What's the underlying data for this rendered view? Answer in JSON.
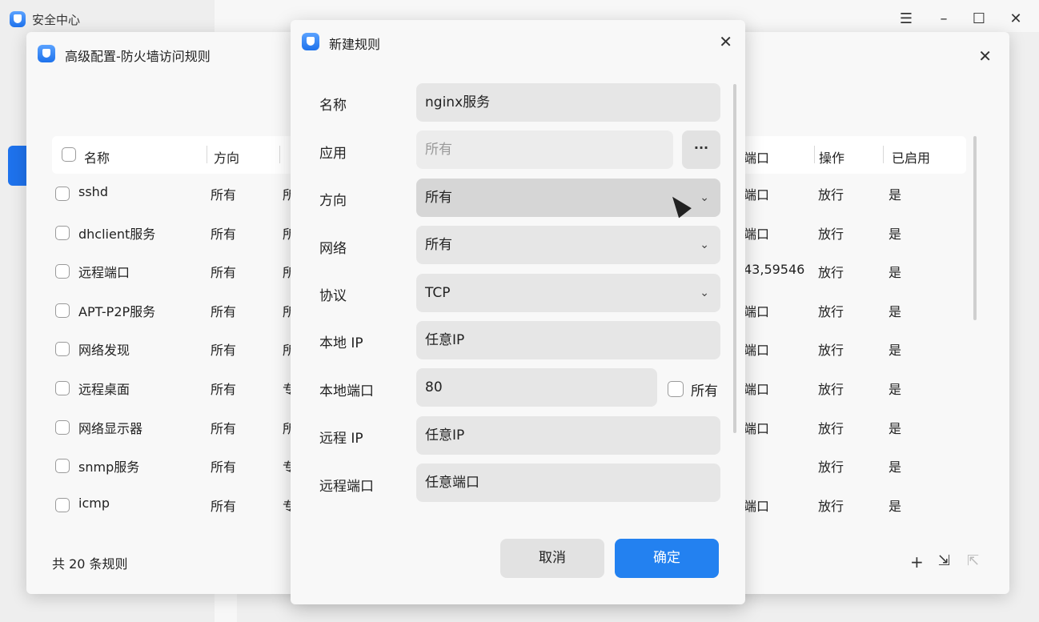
{
  "main_window": {
    "title": "安全中心",
    "menu_icon": "hamburger-icon",
    "minimize_icon": "minimize-icon",
    "maximize_icon": "maximize-icon",
    "close_icon": "close-icon"
  },
  "advanced_window": {
    "title": "高级配置-防火墙访问规则",
    "columns": [
      "名称",
      "方向",
      "端口",
      "操作",
      "已启用"
    ],
    "rows": [
      {
        "name": "sshd",
        "direction": "所有",
        "col3": "所",
        "port": "端口",
        "action": "放行",
        "enabled": "是"
      },
      {
        "name": "dhclient服务",
        "direction": "所有",
        "col3": "所",
        "port": "端口",
        "action": "放行",
        "enabled": "是"
      },
      {
        "name": "远程端口",
        "direction": "所有",
        "col3": "所",
        "port": "43,59546",
        "action": "放行",
        "enabled": "是"
      },
      {
        "name": "APT-P2P服务",
        "direction": "所有",
        "col3": "所",
        "port": "端口",
        "action": "放行",
        "enabled": "是"
      },
      {
        "name": "网络发现",
        "direction": "所有",
        "col3": "所",
        "port": "端口",
        "action": "放行",
        "enabled": "是"
      },
      {
        "name": "远程桌面",
        "direction": "所有",
        "col3": "专",
        "port": "端口",
        "action": "放行",
        "enabled": "是"
      },
      {
        "name": "网络显示器",
        "direction": "所有",
        "col3": "所",
        "port": "端口",
        "action": "放行",
        "enabled": "是"
      },
      {
        "name": "snmp服务",
        "direction": "所有",
        "col3": "专",
        "port": "",
        "action": "放行",
        "enabled": "是"
      },
      {
        "name": "icmp",
        "direction": "所有",
        "col3": "专",
        "port": "端口",
        "action": "放行",
        "enabled": "是"
      }
    ],
    "footer_count": "共 20 条规则",
    "add_icon": "plus-icon",
    "import_icon": "import-icon",
    "export_icon": "export-icon"
  },
  "dialog": {
    "title": "新建规则",
    "fields": {
      "name_label": "名称",
      "name_value": "nginx服务",
      "app_label": "应用",
      "app_placeholder": "所有",
      "app_more": "···",
      "direction_label": "方向",
      "direction_value": "所有",
      "network_label": "网络",
      "network_value": "所有",
      "protocol_label": "协议",
      "protocol_value": "TCP",
      "local_ip_label": "本地 IP",
      "local_ip_value": "任意IP",
      "local_port_label": "本地端口",
      "local_port_value": "80",
      "local_port_all": "所有",
      "remote_ip_label": "远程 IP",
      "remote_ip_value": "任意IP",
      "remote_port_label": "远程端口",
      "remote_port_value": "任意端口"
    },
    "cancel": "取消",
    "ok": "确定",
    "chevron": "chevron-down-icon",
    "close_icon": "close-icon"
  }
}
